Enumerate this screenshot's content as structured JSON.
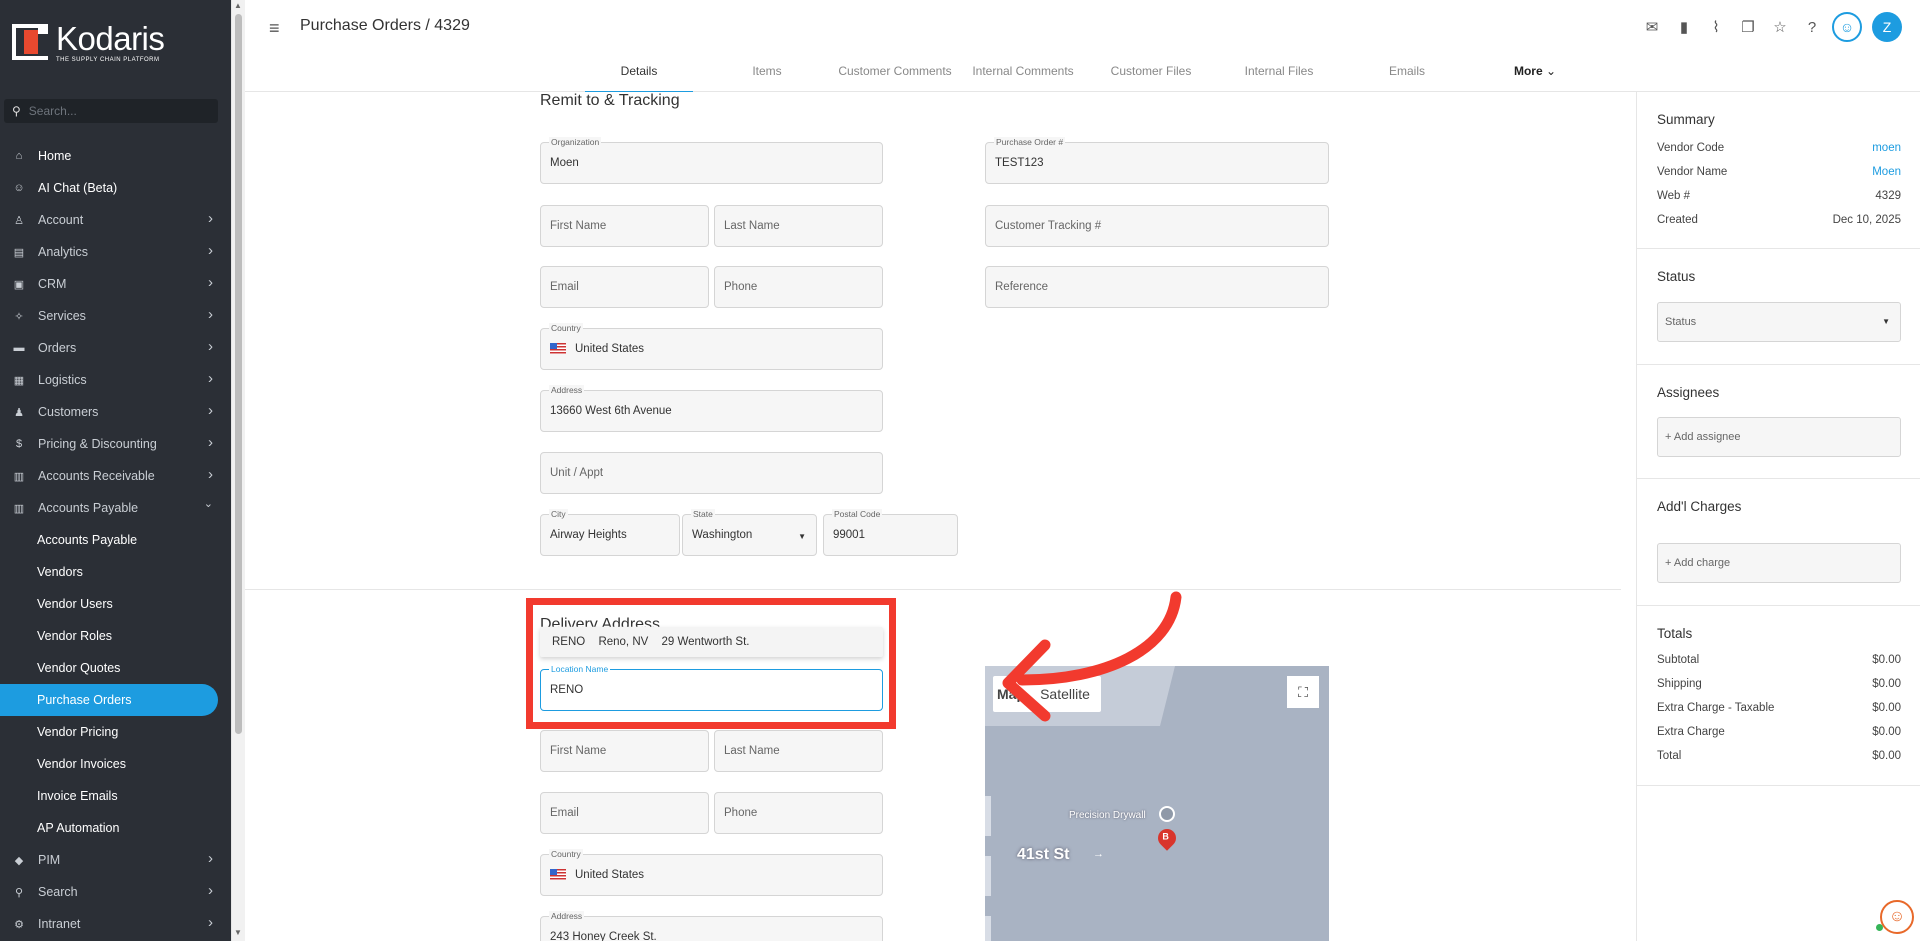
{
  "app": {
    "logo_name": "Kodaris",
    "logo_tagline": "THE SUPPLY CHAIN PLATFORM"
  },
  "sidebar": {
    "search_placeholder": "Search...",
    "items": [
      {
        "label": "Home",
        "icon": "home-icon",
        "glyph": "⌂",
        "chevron": false
      },
      {
        "label": "AI Chat (Beta)",
        "icon": "robot-icon",
        "glyph": "☺",
        "chevron": false
      },
      {
        "label": "Account",
        "icon": "person-icon",
        "glyph": "♙",
        "chevron": true
      },
      {
        "label": "Analytics",
        "icon": "chart-icon",
        "glyph": "▤",
        "chevron": true
      },
      {
        "label": "CRM",
        "icon": "contact-card-icon",
        "glyph": "▣",
        "chevron": true
      },
      {
        "label": "Services",
        "icon": "tools-icon",
        "glyph": "✧",
        "chevron": true
      },
      {
        "label": "Orders",
        "icon": "car-icon",
        "glyph": "▬",
        "chevron": true
      },
      {
        "label": "Logistics",
        "icon": "warehouse-icon",
        "glyph": "▦",
        "chevron": true
      },
      {
        "label": "Customers",
        "icon": "group-icon",
        "glyph": "♟",
        "chevron": true
      },
      {
        "label": "Pricing & Discounting",
        "icon": "dollar-icon",
        "glyph": "$",
        "chevron": true
      },
      {
        "label": "Accounts Receivable",
        "icon": "bank-icon",
        "glyph": "▥",
        "chevron": true
      },
      {
        "label": "Accounts Payable",
        "icon": "bank-icon",
        "glyph": "▥",
        "chevron": "down"
      }
    ],
    "sub_items": [
      {
        "label": "Accounts Payable",
        "active": false
      },
      {
        "label": "Vendors",
        "active": false
      },
      {
        "label": "Vendor Users",
        "active": false
      },
      {
        "label": "Vendor Roles",
        "active": false
      },
      {
        "label": "Vendor Quotes",
        "active": false
      },
      {
        "label": "Purchase Orders",
        "active": true
      },
      {
        "label": "Vendor Pricing",
        "active": false
      },
      {
        "label": "Vendor Invoices",
        "active": false
      },
      {
        "label": "Invoice Emails",
        "active": false
      },
      {
        "label": "AP Automation",
        "active": false
      }
    ],
    "bottom_items": [
      {
        "label": "PIM",
        "icon": "diamond-icon",
        "glyph": "◆",
        "chevron": true
      },
      {
        "label": "Search",
        "icon": "search-icon",
        "glyph": "⚲",
        "chevron": true
      },
      {
        "label": "Intranet",
        "icon": "gear-icon",
        "glyph": "⚙",
        "chevron": true
      }
    ]
  },
  "header": {
    "title": "Purchase Orders / 4329",
    "tabs": [
      "Details",
      "Items",
      "Customer Comments",
      "Internal Comments",
      "Customer Files",
      "Internal Files",
      "Emails",
      "More"
    ],
    "active_tab": "Details",
    "avatar_initial": "Z"
  },
  "remit": {
    "title": "Remit to & Tracking",
    "organization": {
      "label": "Organization",
      "value": "Moen"
    },
    "po_number": {
      "label": "Purchase Order #",
      "value": "TEST123"
    },
    "first_name": {
      "placeholder": "First Name"
    },
    "last_name": {
      "placeholder": "Last Name"
    },
    "customer_tracking": {
      "placeholder": "Customer Tracking #"
    },
    "email": {
      "placeholder": "Email"
    },
    "phone": {
      "placeholder": "Phone"
    },
    "reference": {
      "placeholder": "Reference"
    },
    "country": {
      "label": "Country",
      "value": "United States"
    },
    "address": {
      "label": "Address",
      "value": "13660 West 6th Avenue"
    },
    "unit": {
      "placeholder": "Unit / Appt"
    },
    "city": {
      "label": "City",
      "value": "Airway Heights"
    },
    "state": {
      "label": "State",
      "value": "Washington"
    },
    "postal": {
      "label": "Postal Code",
      "value": "99001"
    }
  },
  "delivery": {
    "title": "Delivery Address",
    "suggestion": {
      "name": "RENO",
      "city": "Reno, NV",
      "street": "29 Wentworth St."
    },
    "location_name": {
      "label": "Location Name",
      "value": "RENO"
    },
    "first_name": {
      "placeholder": "First Name"
    },
    "last_name": {
      "placeholder": "Last Name"
    },
    "email": {
      "placeholder": "Email"
    },
    "phone": {
      "placeholder": "Phone"
    },
    "country": {
      "label": "Country",
      "value": "United States"
    },
    "address": {
      "label": "Address",
      "value": "243 Honey Creek St."
    },
    "map": {
      "map_label": "Map",
      "satellite_label": "Satellite",
      "road": "41st St",
      "poi": "Precision Drywall",
      "pin_letter": "B"
    }
  },
  "summary": {
    "title": "Summary",
    "rows": [
      {
        "label": "Vendor Code",
        "value": "moen",
        "link": true
      },
      {
        "label": "Vendor Name",
        "value": "Moen",
        "link": true
      },
      {
        "label": "Web #",
        "value": "4329",
        "link": false
      },
      {
        "label": "Created",
        "value": "Dec 10, 2025",
        "link": false
      }
    ]
  },
  "status": {
    "title": "Status",
    "placeholder": "Status"
  },
  "assignees": {
    "title": "Assignees",
    "add_label": "+ Add assignee"
  },
  "charges": {
    "title": "Add'l Charges",
    "add_label": "+ Add charge"
  },
  "totals": {
    "title": "Totals",
    "rows": [
      {
        "label": "Subtotal",
        "value": "$0.00"
      },
      {
        "label": "Shipping",
        "value": "$0.00"
      },
      {
        "label": "Extra Charge - Taxable",
        "value": "$0.00"
      },
      {
        "label": "Extra Charge",
        "value": "$0.00"
      },
      {
        "label": "Total",
        "value": "$0.00"
      }
    ]
  },
  "colors": {
    "accent": "#1d9ce0",
    "annotation": "#f23a2e",
    "sidebar_bg": "#2b2f36"
  }
}
